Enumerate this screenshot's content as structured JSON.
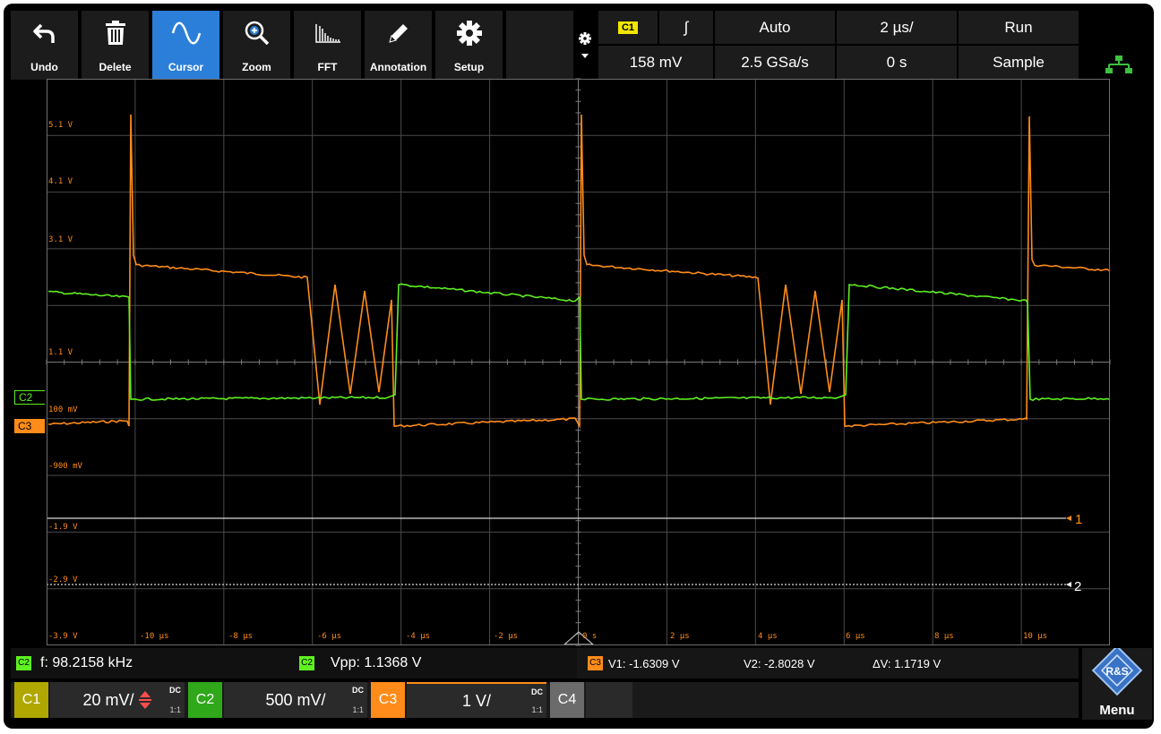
{
  "toolbar": {
    "undo": "Undo",
    "delete": "Delete",
    "cursor": "Cursor",
    "zoom": "Zoom",
    "fft": "FFT",
    "annotation": "Annotation",
    "setup": "Setup"
  },
  "trigger": {
    "source_badge": "C1",
    "slope_symbol": "∫",
    "level": "158 mV",
    "mode": "Auto",
    "sample_rate": "2.5 GSa/s",
    "time_scale": "2 µs/",
    "time_offset": "0 s",
    "run_state": "Run",
    "acq_mode": "Sample"
  },
  "plot": {
    "level_labels": [
      "5.1 V",
      "4.1 V",
      "3.1 V",
      "1.1 V",
      "100 mV",
      "-900 mV",
      "-1.9 V",
      "-2.9 V",
      "-3.9 V"
    ],
    "time_labels": [
      "-10 µs",
      "-8 µs",
      "-6 µs",
      "-4 µs",
      "-2 µs",
      "0 s",
      "2 µs",
      "4 µs",
      "6 µs",
      "8 µs",
      "10 µs"
    ],
    "channel_tags": [
      "C2",
      "C3"
    ],
    "cursor_labels": [
      "1",
      "2"
    ],
    "colors": {
      "c2": "#5ef020",
      "c3": "#ff8c1a",
      "grid": "#4a4a4a",
      "axis": "#7a7a7a"
    }
  },
  "measurements": {
    "freq_tag": "C2",
    "freq": "f: 98.2158 kHz",
    "vpp_tag": "C2",
    "vpp": "Vpp: 1.1368 V",
    "cursor_tag": "C3",
    "v1": "V1: -1.6309 V",
    "v2": "V2: -2.8028 V",
    "dv": "ΔV: 1.1719 V"
  },
  "channels": [
    {
      "label": "C1",
      "scale": "20 mV/",
      "coupling": "DC",
      "ratio": "1:1",
      "color": "#f2e600"
    },
    {
      "label": "C2",
      "scale": "500 mV/",
      "coupling": "DC",
      "ratio": "1:1",
      "color": "#2fa81a"
    },
    {
      "label": "C3",
      "scale": "1 V/",
      "coupling": "DC",
      "ratio": "1:1",
      "color": "#ff8c1a"
    },
    {
      "label": "C4",
      "scale": "",
      "coupling": "",
      "ratio": "",
      "color": "#777777"
    }
  ],
  "menu": {
    "label": "Menu",
    "logo_text": "R&S"
  }
}
